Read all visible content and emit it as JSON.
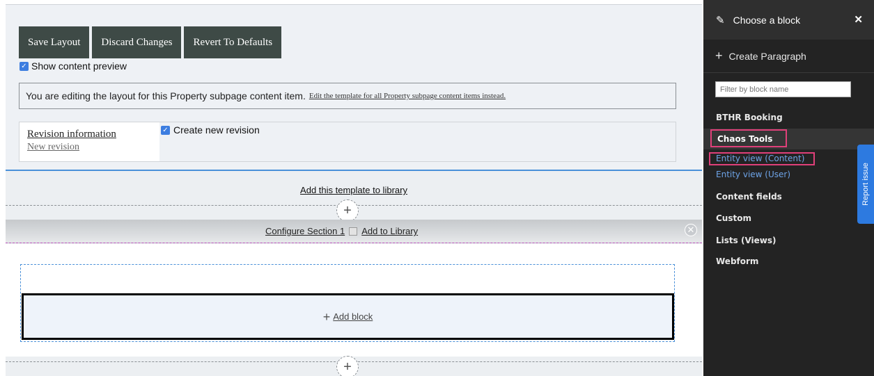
{
  "toolbar": {
    "save_label": "Save Layout",
    "discard_label": "Discard Changes",
    "revert_label": "Revert To Defaults"
  },
  "preview": {
    "label": "Show content preview",
    "checked": true
  },
  "notice": {
    "text": "You are editing the layout for this Property subpage content item.",
    "link": "Edit the template for all Property subpage content items instead."
  },
  "revision": {
    "title": "Revision information",
    "subtitle": "New revision",
    "checkbox_label": "Create new revision",
    "checked": true
  },
  "layout": {
    "library_link": "Add this template to library",
    "configure_link": "Configure Section 1",
    "add_library_link": "Add to Library",
    "add_block_link": "Add block"
  },
  "sidebar": {
    "title": "Choose a block",
    "create_label": "Create Paragraph",
    "filter_placeholder": "Filter by block name",
    "categories": {
      "bthr": "BTHR Booking",
      "chaos": "Chaos Tools",
      "entity_content": "Entity view (Content)",
      "entity_user": "Entity view (User)",
      "content_fields": "Content fields",
      "custom": "Custom",
      "lists": "Lists (Views)",
      "webform": "Webform"
    }
  },
  "report_issue": "Report issue",
  "colors": {
    "button_bg": "#3e4a46",
    "sidebar_bg": "#232323",
    "highlight": "#e0407a",
    "link_blue": "#6ea4e8",
    "report_bg": "#2d7ae0"
  }
}
